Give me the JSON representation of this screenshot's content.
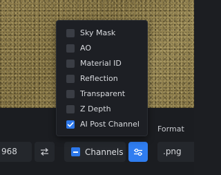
{
  "channel_menu": {
    "items": [
      {
        "label": "Sky Mask",
        "checked": false
      },
      {
        "label": "AO",
        "checked": false
      },
      {
        "label": "Material ID",
        "checked": false
      },
      {
        "label": "Reflection",
        "checked": false
      },
      {
        "label": "Transparent",
        "checked": false
      },
      {
        "label": "Z Depth",
        "checked": false
      },
      {
        "label": "AI Post Channel",
        "checked": true
      }
    ]
  },
  "toolbar": {
    "resolution_value": "968",
    "swap_icon": "swap-arrows-icon",
    "channels_label": "Channels",
    "settings_icon": "sliders-icon",
    "format_label": "Format",
    "format_value": ".png"
  },
  "colors": {
    "accent": "#2f7df0",
    "panel": "#1d1f24",
    "field": "#24272c"
  }
}
